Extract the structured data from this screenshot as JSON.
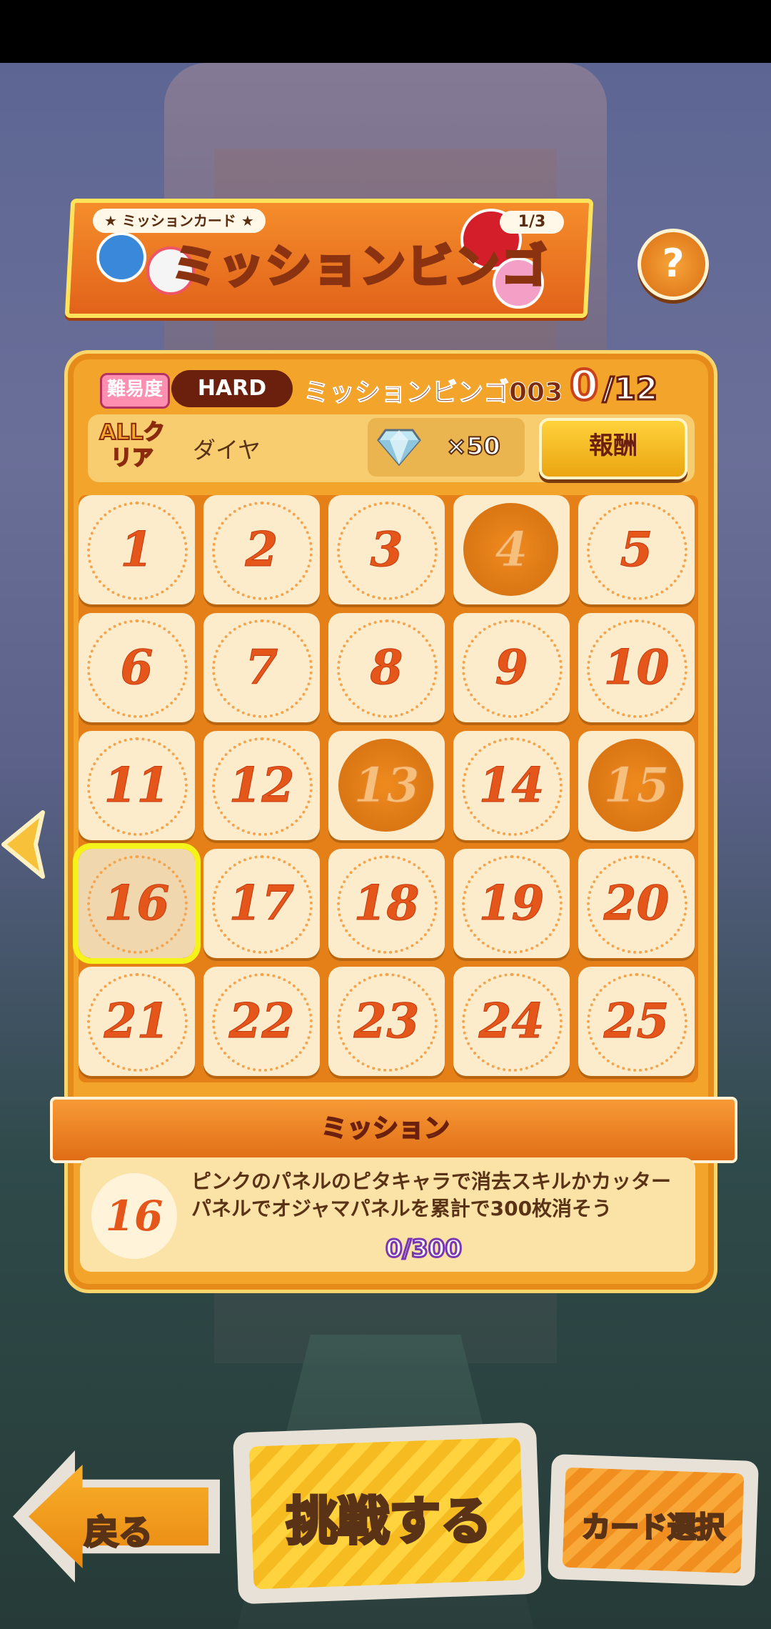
{
  "header": {
    "tag": "★ ミッションカード ★",
    "title": "ミッションビンゴ",
    "page": "1/3",
    "help_label": "?"
  },
  "card": {
    "difficulty_badge": "難易度",
    "difficulty_level": "HARD",
    "bingo_name": "ミッションビンゴ003",
    "progress_current": "0",
    "progress_total": "/12",
    "allclear_badge": "ALLクリア",
    "allclear_reward": "ダイヤ",
    "gem_count": "×50",
    "reward_button": "報酬"
  },
  "grid": {
    "cells": [
      {
        "n": "1",
        "done": false
      },
      {
        "n": "2",
        "done": false
      },
      {
        "n": "3",
        "done": false
      },
      {
        "n": "4",
        "done": true
      },
      {
        "n": "5",
        "done": false
      },
      {
        "n": "6",
        "done": false
      },
      {
        "n": "7",
        "done": false
      },
      {
        "n": "8",
        "done": false
      },
      {
        "n": "9",
        "done": false
      },
      {
        "n": "10",
        "done": false
      },
      {
        "n": "11",
        "done": false
      },
      {
        "n": "12",
        "done": false
      },
      {
        "n": "13",
        "done": true
      },
      {
        "n": "14",
        "done": false
      },
      {
        "n": "15",
        "done": true
      },
      {
        "n": "16",
        "done": false,
        "selected": true
      },
      {
        "n": "17",
        "done": false
      },
      {
        "n": "18",
        "done": false
      },
      {
        "n": "19",
        "done": false
      },
      {
        "n": "20",
        "done": false
      },
      {
        "n": "21",
        "done": false
      },
      {
        "n": "22",
        "done": false
      },
      {
        "n": "23",
        "done": false
      },
      {
        "n": "24",
        "done": false
      },
      {
        "n": "25",
        "done": false
      }
    ]
  },
  "mission": {
    "ribbon_label": "ミッション",
    "number": "16",
    "text": "ピンクのパネルのピタキャラで消去スキルかカッターパネルでオジャマパネルを累計で300枚消そう",
    "progress": "0/300"
  },
  "buttons": {
    "back": "戻る",
    "challenge": "挑戦する",
    "card_select": "カード選択"
  }
}
